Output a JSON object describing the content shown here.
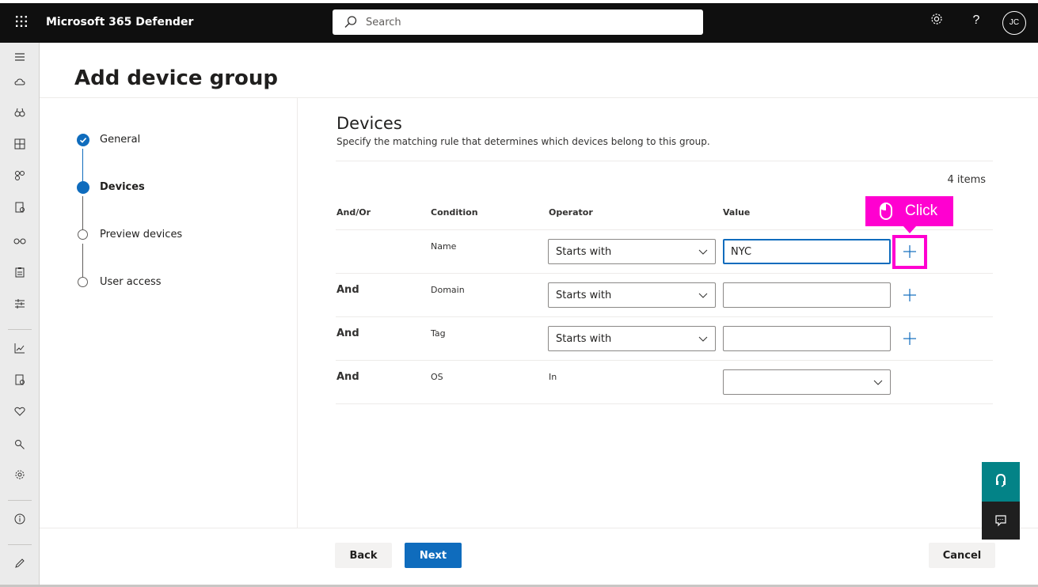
{
  "app": {
    "title": "Microsoft 365 Defender",
    "avatar_initials": "JC"
  },
  "search": {
    "placeholder": "Search"
  },
  "topbar": {
    "icons": [
      "waffle-icon",
      "gear-icon",
      "help-icon"
    ]
  },
  "leftnav": {
    "icons": [
      "hamburger-icon",
      "cloud-icon",
      "binoculars-icon",
      "dashboard-icon",
      "incidents-icon",
      "report-icon",
      "glasses-icon",
      "clipboard-icon",
      "sliders-icon",
      "chart-icon",
      "report2-icon",
      "health-icon",
      "search-people-icon",
      "settings-icon",
      "info-icon",
      "edit-icon"
    ]
  },
  "page": {
    "title": "Add device group"
  },
  "steps": [
    {
      "label": "General",
      "state": "completed"
    },
    {
      "label": "Devices",
      "state": "current"
    },
    {
      "label": "Preview devices",
      "state": "pending"
    },
    {
      "label": "User access",
      "state": "pending"
    }
  ],
  "devices": {
    "title": "Devices",
    "description": "Specify the matching rule that determines which devices belong to this group.",
    "items_count": "4 items",
    "columns": {
      "andor": "And/Or",
      "condition": "Condition",
      "operator": "Operator",
      "value": "Value"
    },
    "rows": [
      {
        "andor": "",
        "condition": "Name",
        "operator": "Starts with",
        "value": "NYC"
      },
      {
        "andor": "And",
        "condition": "Domain",
        "operator": "Starts with",
        "value": ""
      },
      {
        "andor": "And",
        "condition": "Tag",
        "operator": "Starts with",
        "value": ""
      },
      {
        "andor": "And",
        "condition": "OS",
        "operator": "In",
        "value": ""
      }
    ]
  },
  "annotation": {
    "label": "Click",
    "color": "#ff00d0"
  },
  "footer": {
    "back": "Back",
    "next": "Next",
    "cancel": "Cancel"
  },
  "colors": {
    "accent": "#0f6cbd",
    "topbar": "#0f0f0f",
    "teal": "#038387",
    "highlight": "#ff00d0"
  }
}
